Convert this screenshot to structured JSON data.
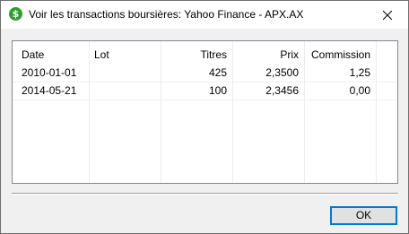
{
  "window": {
    "title": "Voir les transactions boursières: Yahoo Finance - APX.AX",
    "app_icon_glyph": "$",
    "app_icon_color": "#2f9e2f"
  },
  "table": {
    "columns": [
      "Date",
      "Lot",
      "Titres",
      "Prix",
      "Commission"
    ],
    "rows": [
      {
        "date": "2010-01-01",
        "lot": "",
        "titres": "425",
        "prix": "2,3500",
        "commission": "1,25"
      },
      {
        "date": "2014-05-21",
        "lot": "",
        "titres": "100",
        "prix": "2,3456",
        "commission": "0,00"
      }
    ]
  },
  "buttons": {
    "ok_label": "OK"
  },
  "accent_color": "#0078d7"
}
